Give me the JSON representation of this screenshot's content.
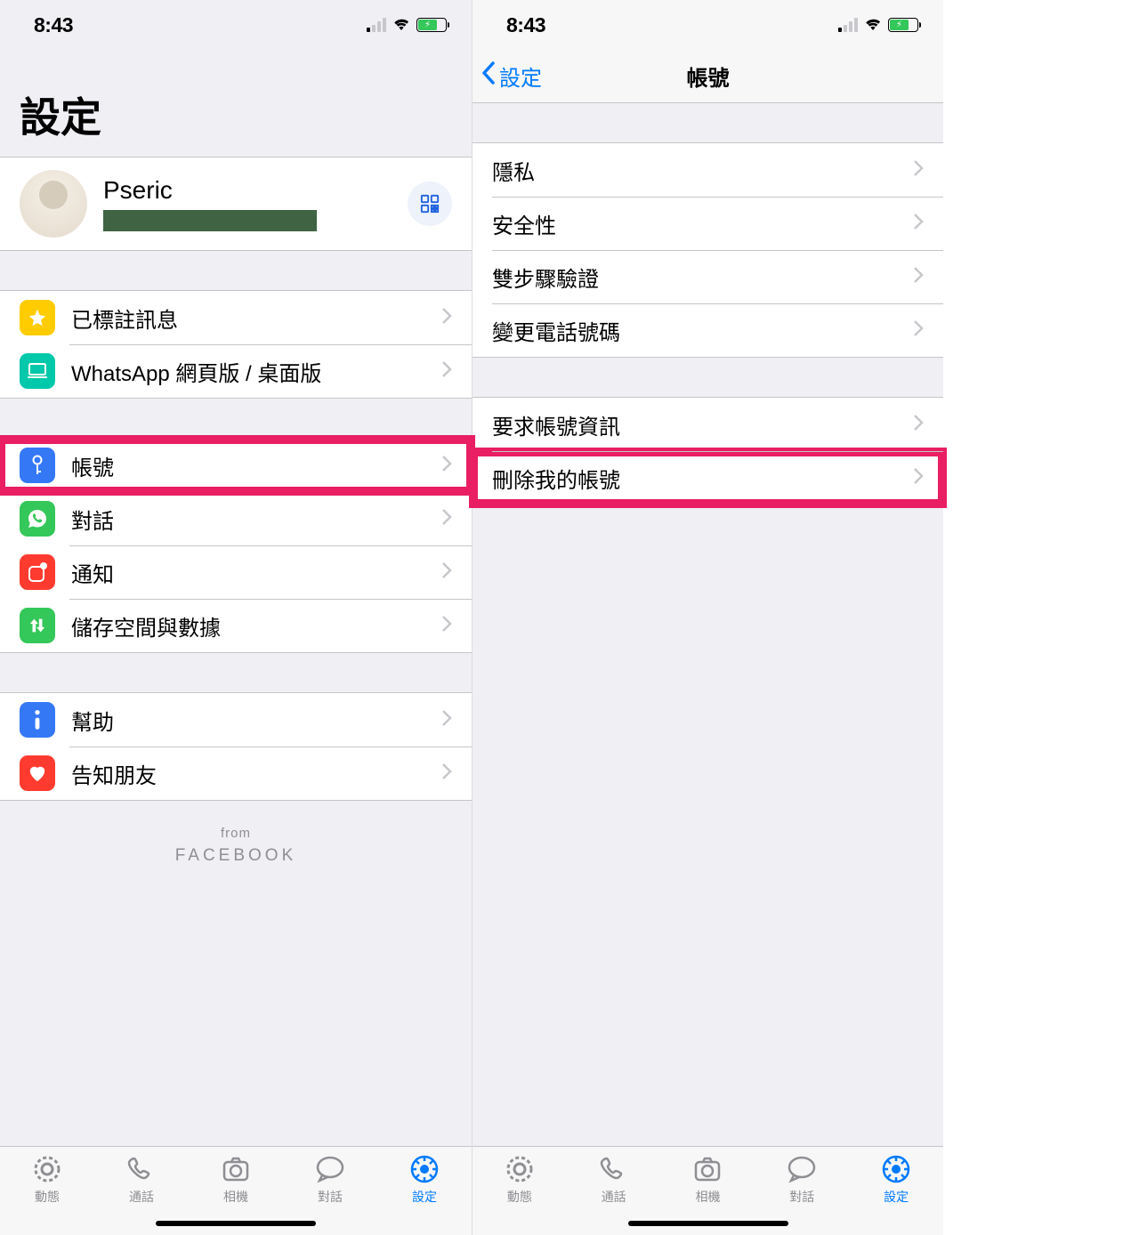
{
  "status": {
    "time": "8:43"
  },
  "left": {
    "title": "設定",
    "profile": {
      "name": "Pseric"
    },
    "group1": [
      {
        "key": "starred",
        "label": "已標註訊息",
        "icon": "star-icon",
        "bg": "bg-yellow"
      },
      {
        "key": "web",
        "label": "WhatsApp 網頁版 / 桌面版",
        "icon": "laptop-icon",
        "bg": "bg-teal"
      }
    ],
    "group2": [
      {
        "key": "account",
        "label": "帳號",
        "icon": "key-icon",
        "bg": "bg-blue",
        "highlight": true
      },
      {
        "key": "chat",
        "label": "對話",
        "icon": "whatsapp-icon",
        "bg": "bg-green"
      },
      {
        "key": "notify",
        "label": "通知",
        "icon": "badge-icon",
        "bg": "bg-red"
      },
      {
        "key": "storage",
        "label": "儲存空間與數據",
        "icon": "updown-icon",
        "bg": "bg-green2"
      }
    ],
    "group3": [
      {
        "key": "help",
        "label": "幫助",
        "icon": "info-icon",
        "bg": "bg-info"
      },
      {
        "key": "tell",
        "label": "告知朋友",
        "icon": "heart-icon",
        "bg": "bg-heart"
      }
    ],
    "footer": {
      "small": "from",
      "big": "FACEBOOK"
    }
  },
  "right": {
    "back": "設定",
    "title": "帳號",
    "group1": [
      {
        "label": "隱私"
      },
      {
        "label": "安全性"
      },
      {
        "label": "雙步驟驗證"
      },
      {
        "label": "變更電話號碼"
      }
    ],
    "group2": [
      {
        "label": "要求帳號資訊"
      },
      {
        "label": "刪除我的帳號",
        "highlight": true
      }
    ]
  },
  "tabs": [
    {
      "label": "動態",
      "icon": "status-icon"
    },
    {
      "label": "通話",
      "icon": "phone-icon"
    },
    {
      "label": "相機",
      "icon": "camera-icon"
    },
    {
      "label": "對話",
      "icon": "chat-icon"
    },
    {
      "label": "設定",
      "icon": "settings-icon",
      "active": true
    }
  ]
}
